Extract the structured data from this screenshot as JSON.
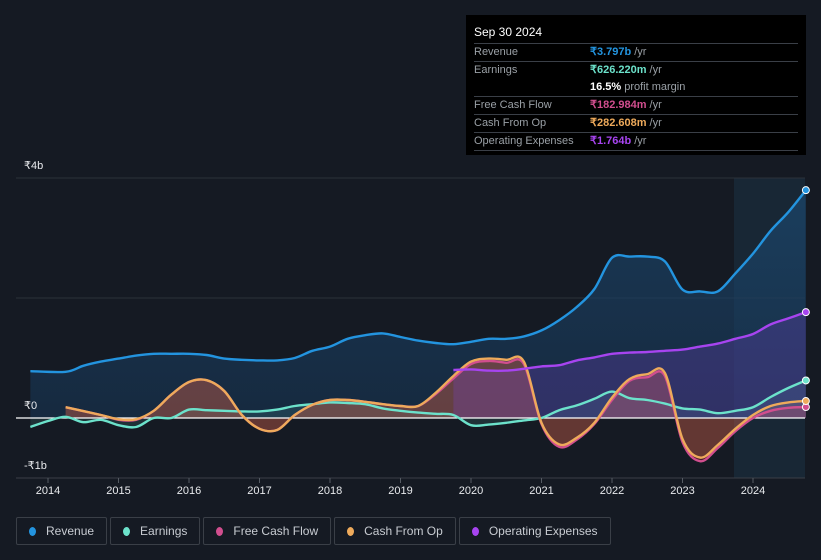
{
  "tooltip": {
    "date": "Sep 30 2024",
    "rows": [
      {
        "label": "Revenue",
        "value": "₹3.797b",
        "unit": "/yr",
        "color": "#2394df"
      },
      {
        "label": "Earnings",
        "value": "₹626.220m",
        "unit": "/yr",
        "color": "#6ce2cb"
      },
      {
        "label": "",
        "value": "16.5%",
        "unit": "profit margin",
        "color": "#ffffff"
      },
      {
        "label": "Free Cash Flow",
        "value": "₹182.984m",
        "unit": "/yr",
        "color": "#d14e8e"
      },
      {
        "label": "Cash From Op",
        "value": "₹282.608m",
        "unit": "/yr",
        "color": "#eeaa5b"
      },
      {
        "label": "Operating Expenses",
        "value": "₹1.764b",
        "unit": "/yr",
        "color": "#a744f0"
      }
    ]
  },
  "legend": [
    {
      "label": "Revenue",
      "color": "#2394df"
    },
    {
      "label": "Earnings",
      "color": "#6ce2cb"
    },
    {
      "label": "Free Cash Flow",
      "color": "#d14e8e"
    },
    {
      "label": "Cash From Op",
      "color": "#eeaa5b"
    },
    {
      "label": "Operating Expenses",
      "color": "#a744f0"
    }
  ],
  "chart_data": {
    "type": "area",
    "title": "",
    "xlabel": "",
    "ylabel": "",
    "currency": "INR",
    "units": "billions",
    "ylim": [
      -1,
      4
    ],
    "xlim": [
      2013.7,
      2024.75
    ],
    "y_ticks": [
      {
        "value": 4,
        "label": "₹4b"
      },
      {
        "value": 0,
        "label": "₹0"
      },
      {
        "value": -1,
        "label": "-₹1b"
      }
    ],
    "x_ticks": [
      "2014",
      "2015",
      "2016",
      "2017",
      "2018",
      "2019",
      "2020",
      "2021",
      "2022",
      "2023",
      "2024"
    ],
    "grid": true,
    "highlight_from": 2023.75,
    "legend_position": "bottom-left",
    "series": [
      {
        "name": "Revenue",
        "color": "#2394df",
        "points": [
          [
            2013.75,
            0.78
          ],
          [
            2014.25,
            0.77
          ],
          [
            2014.5,
            0.87
          ],
          [
            2014.75,
            0.94
          ],
          [
            2015,
            0.99
          ],
          [
            2015.25,
            1.04
          ],
          [
            2015.5,
            1.07
          ],
          [
            2015.75,
            1.07
          ],
          [
            2016,
            1.07
          ],
          [
            2016.25,
            1.05
          ],
          [
            2016.5,
            0.99
          ],
          [
            2016.75,
            0.97
          ],
          [
            2017,
            0.96
          ],
          [
            2017.25,
            0.96
          ],
          [
            2017.5,
            1.0
          ],
          [
            2017.75,
            1.12
          ],
          [
            2018,
            1.19
          ],
          [
            2018.25,
            1.32
          ],
          [
            2018.5,
            1.38
          ],
          [
            2018.75,
            1.41
          ],
          [
            2019,
            1.35
          ],
          [
            2019.25,
            1.29
          ],
          [
            2019.5,
            1.25
          ],
          [
            2019.75,
            1.23
          ],
          [
            2020,
            1.27
          ],
          [
            2020.25,
            1.32
          ],
          [
            2020.5,
            1.32
          ],
          [
            2020.75,
            1.36
          ],
          [
            2021,
            1.46
          ],
          [
            2021.25,
            1.63
          ],
          [
            2021.5,
            1.85
          ],
          [
            2021.75,
            2.15
          ],
          [
            2022,
            2.67
          ],
          [
            2022.25,
            2.69
          ],
          [
            2022.5,
            2.69
          ],
          [
            2022.75,
            2.61
          ],
          [
            2023,
            2.14
          ],
          [
            2023.25,
            2.11
          ],
          [
            2023.5,
            2.11
          ],
          [
            2023.75,
            2.41
          ],
          [
            2024,
            2.74
          ],
          [
            2024.25,
            3.12
          ],
          [
            2024.5,
            3.43
          ],
          [
            2024.75,
            3.797
          ]
        ]
      },
      {
        "name": "Earnings",
        "color": "#6ce2cb",
        "points": [
          [
            2013.75,
            -0.15
          ],
          [
            2014,
            -0.05
          ],
          [
            2014.25,
            0.02
          ],
          [
            2014.5,
            -0.07
          ],
          [
            2014.75,
            -0.03
          ],
          [
            2015,
            -0.12
          ],
          [
            2015.25,
            -0.15
          ],
          [
            2015.5,
            0.0
          ],
          [
            2015.75,
            0.0
          ],
          [
            2016,
            0.14
          ],
          [
            2016.25,
            0.13
          ],
          [
            2016.5,
            0.12
          ],
          [
            2016.75,
            0.11
          ],
          [
            2017,
            0.11
          ],
          [
            2017.25,
            0.14
          ],
          [
            2017.5,
            0.2
          ],
          [
            2017.75,
            0.23
          ],
          [
            2018,
            0.26
          ],
          [
            2018.25,
            0.25
          ],
          [
            2018.5,
            0.23
          ],
          [
            2018.75,
            0.16
          ],
          [
            2019,
            0.12
          ],
          [
            2019.25,
            0.09
          ],
          [
            2019.5,
            0.07
          ],
          [
            2019.75,
            0.05
          ],
          [
            2020,
            -0.12
          ],
          [
            2020.25,
            -0.11
          ],
          [
            2020.5,
            -0.08
          ],
          [
            2020.75,
            -0.04
          ],
          [
            2021,
            0.0
          ],
          [
            2021.25,
            0.13
          ],
          [
            2021.5,
            0.21
          ],
          [
            2021.75,
            0.32
          ],
          [
            2022,
            0.44
          ],
          [
            2022.25,
            0.33
          ],
          [
            2022.5,
            0.3
          ],
          [
            2022.75,
            0.24
          ],
          [
            2023,
            0.16
          ],
          [
            2023.25,
            0.14
          ],
          [
            2023.5,
            0.08
          ],
          [
            2023.75,
            0.12
          ],
          [
            2024,
            0.18
          ],
          [
            2024.25,
            0.35
          ],
          [
            2024.5,
            0.5
          ],
          [
            2024.75,
            0.626
          ]
        ]
      },
      {
        "name": "Free Cash Flow",
        "color": "#d14e8e",
        "points": [
          [
            2014.25,
            0.18
          ],
          [
            2014.75,
            0.05
          ],
          [
            2015,
            -0.03
          ],
          [
            2015.25,
            -0.03
          ],
          [
            2015.5,
            0.12
          ],
          [
            2015.75,
            0.39
          ],
          [
            2016,
            0.6
          ],
          [
            2016.25,
            0.63
          ],
          [
            2016.5,
            0.45
          ],
          [
            2016.75,
            0.05
          ],
          [
            2017,
            -0.18
          ],
          [
            2017.25,
            -0.2
          ],
          [
            2017.5,
            0.05
          ],
          [
            2017.75,
            0.22
          ],
          [
            2018,
            0.3
          ],
          [
            2018.25,
            0.3
          ],
          [
            2018.5,
            0.27
          ],
          [
            2018.75,
            0.23
          ],
          [
            2019,
            0.2
          ],
          [
            2019.25,
            0.2
          ],
          [
            2019.5,
            0.4
          ],
          [
            2019.75,
            0.66
          ],
          [
            2020,
            0.9
          ],
          [
            2020.25,
            0.95
          ],
          [
            2020.5,
            0.92
          ],
          [
            2020.75,
            0.9
          ],
          [
            2021,
            -0.1
          ],
          [
            2021.25,
            -0.48
          ],
          [
            2021.5,
            -0.36
          ],
          [
            2021.75,
            -0.1
          ],
          [
            2022,
            0.3
          ],
          [
            2022.25,
            0.62
          ],
          [
            2022.5,
            0.68
          ],
          [
            2022.75,
            0.7
          ],
          [
            2023,
            -0.4
          ],
          [
            2023.25,
            -0.72
          ],
          [
            2023.5,
            -0.5
          ],
          [
            2023.75,
            -0.22
          ],
          [
            2024,
            0.0
          ],
          [
            2024.25,
            0.12
          ],
          [
            2024.5,
            0.17
          ],
          [
            2024.75,
            0.183
          ]
        ]
      },
      {
        "name": "Cash From Op",
        "color": "#eeaa5b",
        "points": [
          [
            2014.25,
            0.18
          ],
          [
            2014.75,
            0.05
          ],
          [
            2015,
            -0.02
          ],
          [
            2015.25,
            -0.02
          ],
          [
            2015.5,
            0.12
          ],
          [
            2015.75,
            0.39
          ],
          [
            2016,
            0.6
          ],
          [
            2016.25,
            0.63
          ],
          [
            2016.5,
            0.45
          ],
          [
            2016.75,
            0.05
          ],
          [
            2017,
            -0.18
          ],
          [
            2017.25,
            -0.2
          ],
          [
            2017.5,
            0.05
          ],
          [
            2017.75,
            0.22
          ],
          [
            2018,
            0.3
          ],
          [
            2018.25,
            0.3
          ],
          [
            2018.5,
            0.27
          ],
          [
            2018.75,
            0.23
          ],
          [
            2019,
            0.2
          ],
          [
            2019.25,
            0.2
          ],
          [
            2019.5,
            0.42
          ],
          [
            2019.75,
            0.7
          ],
          [
            2020,
            0.94
          ],
          [
            2020.25,
            0.99
          ],
          [
            2020.5,
            0.97
          ],
          [
            2020.75,
            0.94
          ],
          [
            2021,
            -0.08
          ],
          [
            2021.25,
            -0.44
          ],
          [
            2021.5,
            -0.33
          ],
          [
            2021.75,
            -0.08
          ],
          [
            2022,
            0.34
          ],
          [
            2022.25,
            0.65
          ],
          [
            2022.5,
            0.73
          ],
          [
            2022.75,
            0.75
          ],
          [
            2023,
            -0.35
          ],
          [
            2023.25,
            -0.66
          ],
          [
            2023.5,
            -0.45
          ],
          [
            2023.75,
            -0.18
          ],
          [
            2024,
            0.05
          ],
          [
            2024.25,
            0.2
          ],
          [
            2024.5,
            0.26
          ],
          [
            2024.75,
            0.283
          ]
        ]
      },
      {
        "name": "Operating Expenses",
        "color": "#a744f0",
        "points": [
          [
            2019.75,
            0.8
          ],
          [
            2020,
            0.81
          ],
          [
            2020.25,
            0.79
          ],
          [
            2020.5,
            0.79
          ],
          [
            2020.75,
            0.82
          ],
          [
            2021,
            0.86
          ],
          [
            2021.25,
            0.88
          ],
          [
            2021.5,
            0.96
          ],
          [
            2021.75,
            1.01
          ],
          [
            2022,
            1.07
          ],
          [
            2022.25,
            1.09
          ],
          [
            2022.5,
            1.1
          ],
          [
            2022.75,
            1.12
          ],
          [
            2023,
            1.14
          ],
          [
            2023.25,
            1.19
          ],
          [
            2023.5,
            1.24
          ],
          [
            2023.75,
            1.32
          ],
          [
            2024,
            1.4
          ],
          [
            2024.25,
            1.56
          ],
          [
            2024.5,
            1.66
          ],
          [
            2024.75,
            1.764
          ]
        ]
      }
    ]
  }
}
